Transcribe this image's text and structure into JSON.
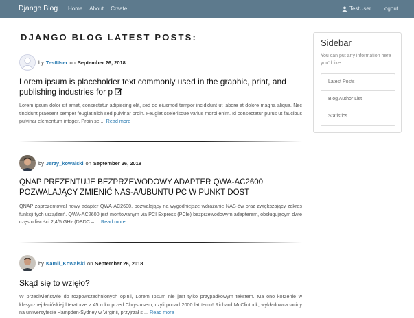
{
  "navbar": {
    "brand": "Django Blog",
    "links": [
      "Home",
      "About",
      "Create"
    ],
    "user": "TestUser",
    "logout": "Logout"
  },
  "main": {
    "heading": "DJANGO BLOG LATEST POSTS:"
  },
  "posts": [
    {
      "author": "TestUser",
      "date": "September 26, 2018",
      "title": "Lorem ipsum is placeholder text commonly used in the graphic, print, and publishing industries for p",
      "excerpt": "Lorem ipsum dolor sit amet, consectetur adipiscing elit, sed do eiusmod tempor incididunt ut labore et dolore magna aliqua. Nec tincidunt praesent semper feugiat nibh sed pulvinar proin. Feugiat scelerisque varius morbi enim. Id consectetur purus ut faucibus pulvinar elementum integer. Proin se ...",
      "read_more": "Read more"
    },
    {
      "author": "Jerzy_kowalski",
      "date": "September 26, 2018",
      "title": "QNAP PREZENTUJE BEZPRZEWODOWY ADAPTER QWA-AC2600 POZWALAJĄCY ZMIENIĆ NAS-A/UBUNTU PC W PUNKT DOST",
      "excerpt": "QNAP zaprezentował nowy adapter QWA-AC2600, pozwalający na wygodniejsze wdrażanie NAS-ów oraz zwiększający zakres funkcji tych urządzeń. QWA-AC2600 jest montowanym via PCI Express (PCIe) bezprzewodowym adapterem, obsługującym dwie częstotliwości 2,4/5 GHz (DBDC – ...",
      "read_more": "Read more"
    },
    {
      "author": "Kamil_Kowalski",
      "date": "September 26, 2018",
      "title": "Skąd się to wzięło?",
      "excerpt": "W przeciwieństwie do rozpowszechnionych opinii, Lorem Ipsum nie jest tylko przypadkowym tekstem. Ma ono korzenie w klasycznej łacińskiej literaturze z 45 roku przed Chrystusem, czyli ponad 2000 lat temu! Richard McClintock, wykładowca łaciny na uniwersytecie Hampden-Sydney w Virginii, przyjrzał s ...",
      "read_more": "Read more"
    }
  ],
  "by_label": "by",
  "on_label": "on",
  "sidebar": {
    "title": "Sidebar",
    "description": "You can put any information here you'd like.",
    "items": [
      "Latest Posts",
      "Blog Author List",
      "Statistics"
    ]
  }
}
